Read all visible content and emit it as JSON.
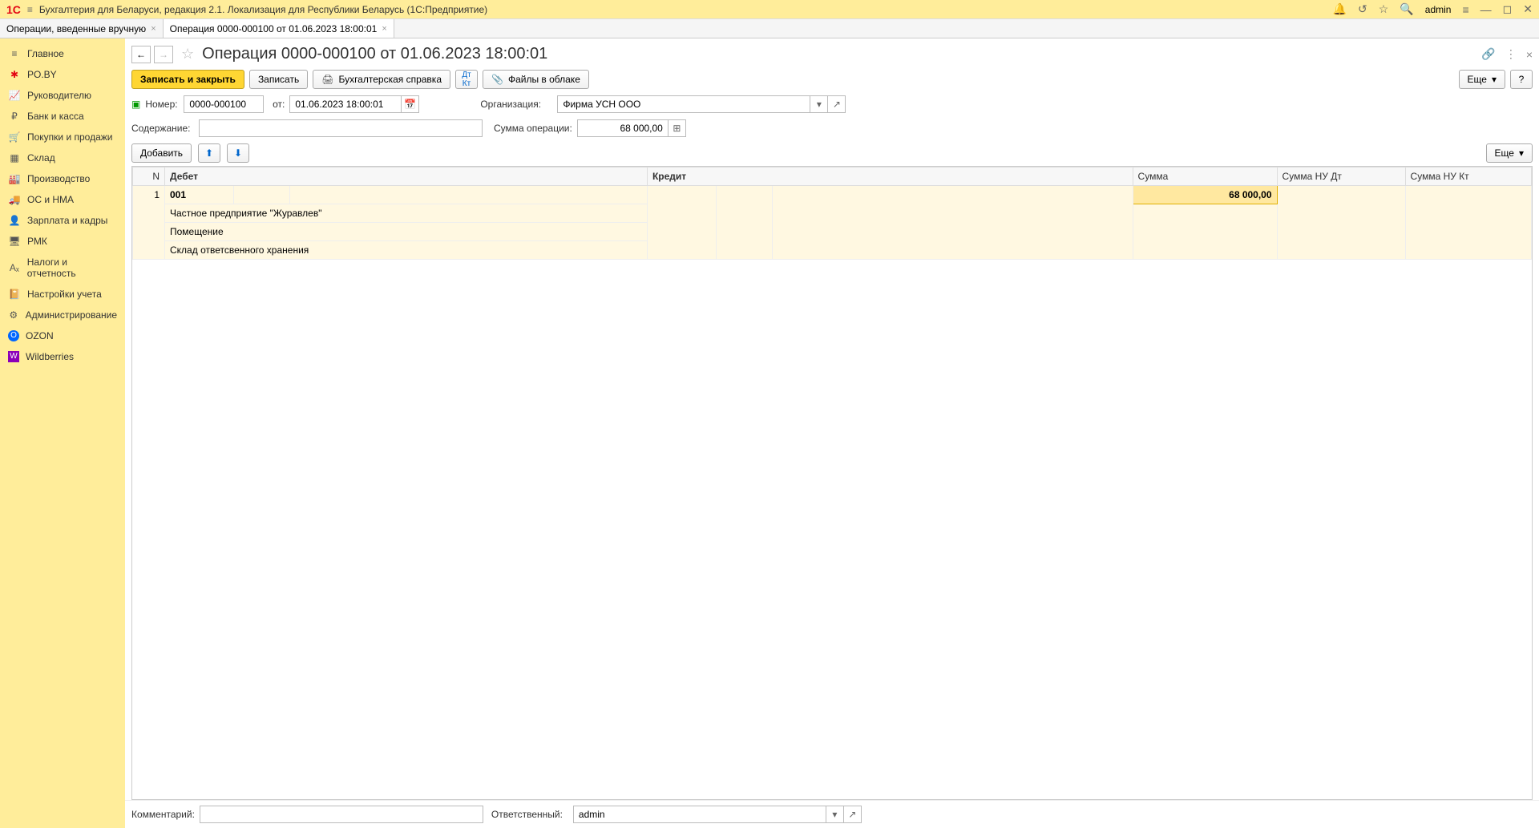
{
  "titlebar": {
    "app_title": "Бухгалтерия для Беларуси, редакция 2.1. Локализация для Республики Беларусь   (1С:Предприятие)",
    "user": "admin"
  },
  "tabs": [
    {
      "label": "Операции, введенные вручную",
      "active": false
    },
    {
      "label": "Операция 0000-000100 от 01.06.2023 18:00:01",
      "active": true
    }
  ],
  "sidebar": [
    {
      "icon": "≡",
      "label": "Главное"
    },
    {
      "icon": "✱",
      "label": "PO.BY",
      "color": "#e30613"
    },
    {
      "icon": "📈",
      "label": "Руководителю"
    },
    {
      "icon": "₽",
      "label": "Банк и касса"
    },
    {
      "icon": "🛒",
      "label": "Покупки и продажи"
    },
    {
      "icon": "▦",
      "label": "Склад"
    },
    {
      "icon": "🏭",
      "label": "Производство"
    },
    {
      "icon": "🚚",
      "label": "ОС и НМА"
    },
    {
      "icon": "👤",
      "label": "Зарплата и кадры"
    },
    {
      "icon": "🖥",
      "label": "РМК"
    },
    {
      "icon": "Aₓ",
      "label": "Налоги и отчетность"
    },
    {
      "icon": "📔",
      "label": "Настройки учета"
    },
    {
      "icon": "⚙",
      "label": "Администрирование"
    },
    {
      "icon": "O",
      "label": "OZON",
      "color": "#0066ff"
    },
    {
      "icon": "W",
      "label": "Wildberries",
      "color": "#8b00b8"
    }
  ],
  "page": {
    "title": "Операция 0000-000100 от 01.06.2023 18:00:01",
    "toolbar": {
      "save_close": "Записать и закрыть",
      "save": "Записать",
      "acc_note": "Бухгалтерская справка",
      "files": "Файлы в облаке",
      "more": "Еще"
    },
    "form": {
      "number_label": "Номер:",
      "number": "0000-000100",
      "from_label": "от:",
      "date": "01.06.2023 18:00:01",
      "org_label": "Организация:",
      "org": "Фирма УСН ООО",
      "content_label": "Содержание:",
      "content": "",
      "sum_label": "Сумма операции:",
      "sum": "68 000,00"
    },
    "table_toolbar": {
      "add": "Добавить",
      "more": "Еще"
    },
    "table": {
      "headers": {
        "n": "N",
        "debit": "Дебет",
        "credit": "Кредит",
        "sum": "Сумма",
        "nu_dt": "Сумма НУ Дт",
        "nu_kt": "Сумма НУ Кт"
      },
      "rows": [
        {
          "n": "1",
          "account": "001",
          "sub1": "Частное предприятие \"Журавлев\"",
          "sub2": "Помещение",
          "sub3": "Склад ответсвенного хранения",
          "credit": "",
          "sum": "68 000,00",
          "nu_dt": "",
          "nu_kt": ""
        }
      ]
    },
    "footer": {
      "comment_label": "Комментарий:",
      "comment": "",
      "resp_label": "Ответственный:",
      "resp": "admin"
    }
  }
}
